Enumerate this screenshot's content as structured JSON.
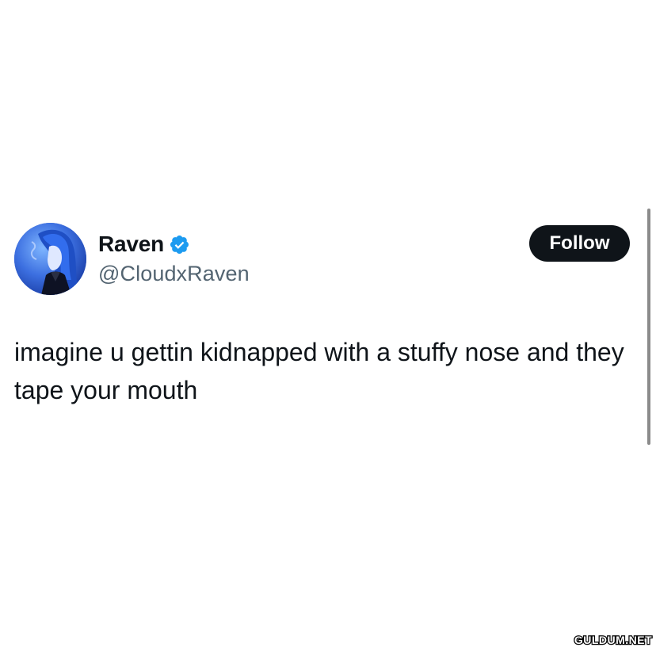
{
  "tweet": {
    "display_name": "Raven",
    "handle": "@CloudxRaven",
    "verified": true,
    "follow_label": "Follow",
    "text": "imagine u gettin kidnapped with a stuffy nose and they tape your mouth"
  },
  "icons": {
    "verified": "verified-badge-icon",
    "avatar": "anime-character-avatar"
  },
  "watermark": {
    "text": "GULDUM.NET"
  },
  "colors": {
    "verified_blue": "#1d9bf0",
    "follow_bg": "#0f1419",
    "handle_gray": "#536471",
    "text": "#0f1419"
  }
}
